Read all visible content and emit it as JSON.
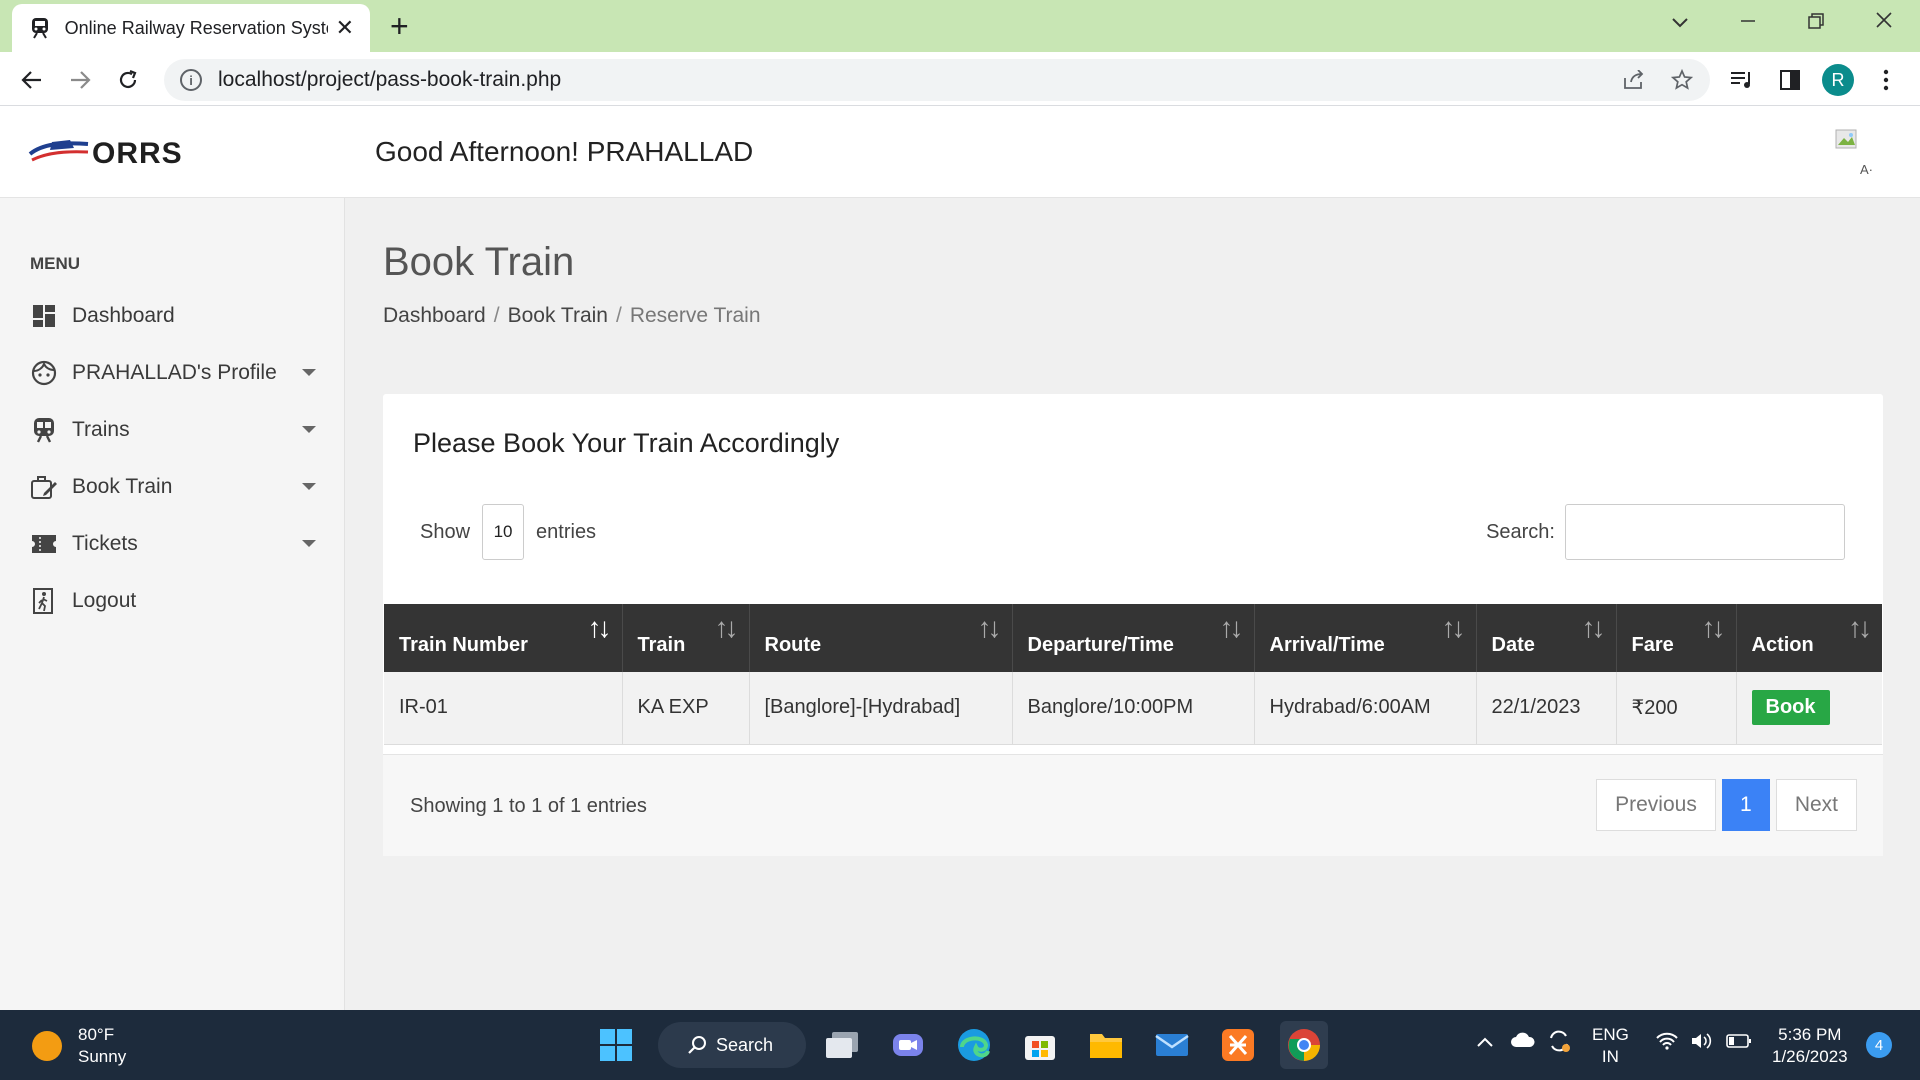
{
  "browser": {
    "tab_title": "Online Railway Reservation System",
    "new_tab_glyph": "+",
    "url": "localhost/project/pass-book-train.php",
    "profile_initial": "R"
  },
  "header": {
    "logo_text": "ORRS",
    "greeting": "Good Afternoon! PRAHALLAD",
    "user_image_alt": "A·"
  },
  "sidebar": {
    "heading": "MENU",
    "items": [
      {
        "label": "Dashboard",
        "icon": "dashboard-icon",
        "has_caret": false
      },
      {
        "label": "PRAHALLAD's Profile",
        "icon": "face-icon",
        "has_caret": true
      },
      {
        "label": "Trains",
        "icon": "train-icon",
        "has_caret": true
      },
      {
        "label": "Book Train",
        "icon": "book-train-icon",
        "has_caret": true
      },
      {
        "label": "Tickets",
        "icon": "ticket-icon",
        "has_caret": true
      },
      {
        "label": "Logout",
        "icon": "logout-icon",
        "has_caret": false
      }
    ]
  },
  "main": {
    "page_title": "Book Train",
    "breadcrumb": [
      "Dashboard",
      "Book Train",
      "Reserve Train"
    ],
    "card_title": "Please Book Your Train Accordingly",
    "show_label": "Show",
    "entries_value": "10",
    "entries_label": "entries",
    "search_label": "Search:",
    "table": {
      "headers": [
        "Train Number",
        "Train",
        "Route",
        "Departure/Time",
        "Arrival/Time",
        "Date",
        "Fare",
        "Action"
      ],
      "rows": [
        {
          "train_number": "IR-01",
          "train": "KA EXP",
          "route": "[Banglore]-[Hydrabad]",
          "departure": "Banglore/10:00PM",
          "arrival": "Hydrabad/6:00AM",
          "date": "22/1/2023",
          "fare": "₹200",
          "action": "Book"
        }
      ]
    },
    "showing_text": "Showing 1 to 1 of 1 entries",
    "pagination": {
      "previous": "Previous",
      "current": "1",
      "next": "Next"
    }
  },
  "taskbar": {
    "temperature": "80°F",
    "condition": "Sunny",
    "search_label": "Search",
    "lang_top": "ENG",
    "lang_bottom": "IN",
    "time": "5:36 PM",
    "date": "1/26/2023",
    "notification_count": "4"
  },
  "colors": {
    "tabbar_bg": "#c8e6b4",
    "table_header_bg": "#343434",
    "book_button": "#28a745",
    "active_page": "#3b82f6",
    "taskbar_bg": "#1d2b3c"
  }
}
